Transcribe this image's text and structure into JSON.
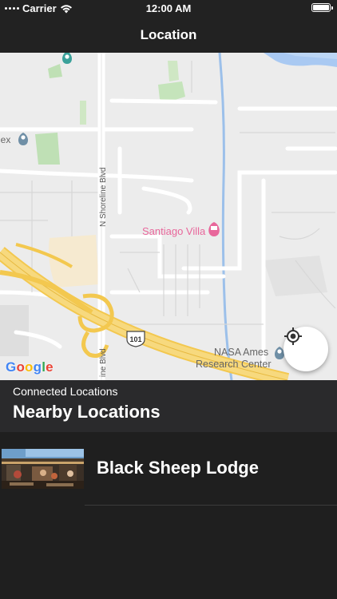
{
  "status": {
    "carrier": "Carrier",
    "time": "12:00 AM"
  },
  "nav": {
    "title": "Location"
  },
  "map": {
    "labels": {
      "road_shoreline_top": "N Shoreline Blvd",
      "road_shoreline_bottom": "ine Blvd",
      "poi_santiago": "Santiago Villa",
      "poi_nasa_line1": "NASA Ames",
      "poi_nasa_line2": "Research Center",
      "poi_left": "lex",
      "route_shield": "101"
    },
    "google_letters": [
      "G",
      "o",
      "o",
      "g",
      "l",
      "e"
    ]
  },
  "section": {
    "subtitle": "Connected Locations",
    "title": "Nearby Locations"
  },
  "locations": [
    {
      "name": "Black Sheep Lodge"
    }
  ],
  "colors": {
    "background": "#1f1f1f",
    "bar": "#222222",
    "section": "#2a2a2c",
    "map_land": "#ececec",
    "highway": "#f6d36b",
    "poi_pink": "#e8679b",
    "water": "#a9c9f2",
    "park": "#bfe0b5"
  },
  "icons": [
    "wifi-icon",
    "battery-icon",
    "signal-icon",
    "location-target-icon",
    "map-pin-icon",
    "hotel-pin-icon"
  ]
}
